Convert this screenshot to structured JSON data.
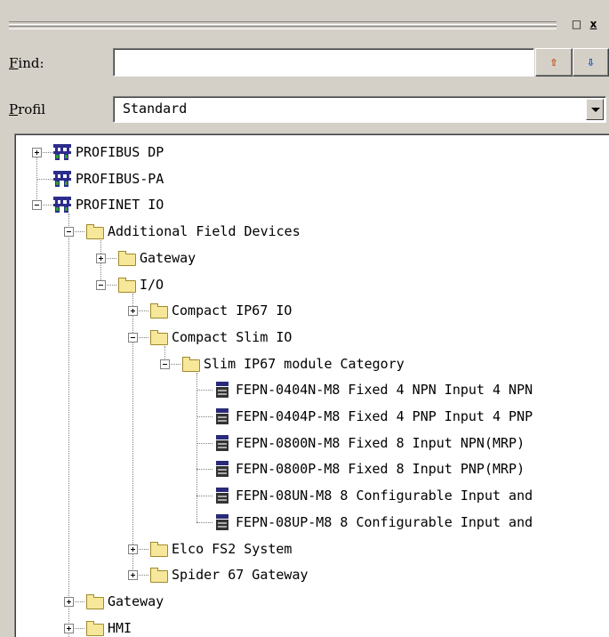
{
  "window": {
    "restore_label": "□",
    "close_label": "x"
  },
  "find": {
    "label_key": "F",
    "label_rest": "ind:",
    "value": "",
    "placeholder": "",
    "search_up_label": "⇧",
    "search_down_label": "⇩"
  },
  "profile": {
    "label_key": "P",
    "label_rest": "rofil",
    "selected": "Standard"
  },
  "tree": {
    "items": [
      {
        "label": "PROFIBUS DP",
        "icon": "network-icon"
      },
      {
        "label": "PROFIBUS-PA",
        "icon": "network-icon"
      },
      {
        "label": "PROFINET IO",
        "icon": "network-icon"
      },
      {
        "label": "Additional Field Devices",
        "icon": "folder-icon"
      },
      {
        "label": "Gateway",
        "icon": "folder-icon"
      },
      {
        "label": "I/O",
        "icon": "folder-icon"
      },
      {
        "label": "Compact IP67 IO",
        "icon": "folder-icon"
      },
      {
        "label": "Compact Slim IO",
        "icon": "folder-icon"
      },
      {
        "label": "Slim IP67 module Category",
        "icon": "folder-icon"
      },
      {
        "label": "FEPN-0404N-M8 Fixed 4 NPN Input 4 NPN",
        "icon": "device-icon"
      },
      {
        "label": "FEPN-0404P-M8 Fixed 4 PNP Input 4 PNP",
        "icon": "device-icon"
      },
      {
        "label": "FEPN-0800N-M8 Fixed 8 Input NPN(MRP)",
        "icon": "device-icon"
      },
      {
        "label": "FEPN-0800P-M8 Fixed 8 Input PNP(MRP)",
        "icon": "device-icon"
      },
      {
        "label": "FEPN-08UN-M8 8 Configurable Input and",
        "icon": "device-icon"
      },
      {
        "label": "FEPN-08UP-M8 8 Configurable Input and",
        "icon": "device-icon"
      },
      {
        "label": "Elco FS2 System",
        "icon": "folder-icon"
      },
      {
        "label": "Spider 67 Gateway",
        "icon": "folder-icon"
      },
      {
        "label": "Gateway",
        "icon": "folder-icon"
      },
      {
        "label": "HMI",
        "icon": "folder-icon"
      }
    ]
  }
}
